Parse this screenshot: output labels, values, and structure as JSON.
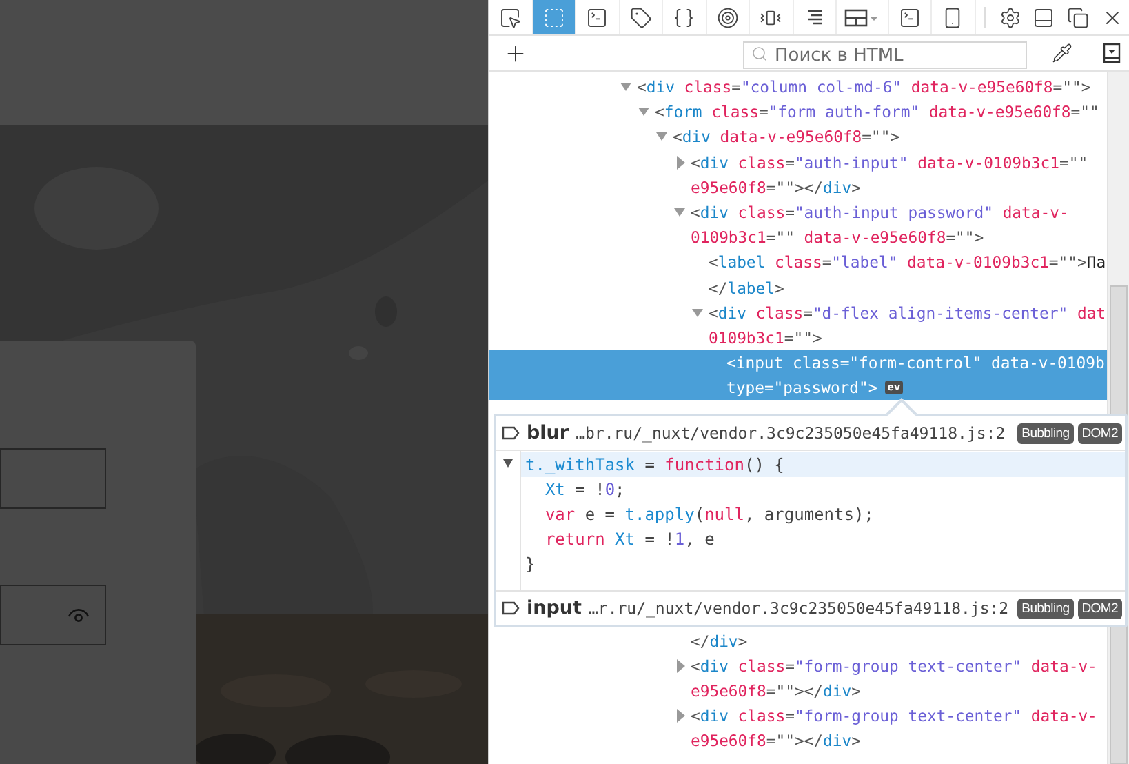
{
  "page": {
    "login_form": {
      "fields": [
        {
          "kind": "text"
        },
        {
          "kind": "password"
        }
      ]
    }
  },
  "devtools": {
    "toolbar": {
      "tabs": [
        {
          "kind": "pointer",
          "selected": false
        },
        {
          "kind": "frame",
          "selected": true
        },
        {
          "kind": "terminal",
          "selected": false
        },
        {
          "kind": "tag",
          "selected": false
        },
        {
          "kind": "braces",
          "selected": false
        },
        {
          "kind": "target",
          "selected": false
        },
        {
          "kind": "vibrate",
          "selected": false
        },
        {
          "kind": "lines",
          "selected": false
        },
        {
          "kind": "layout",
          "selected": false
        },
        {
          "kind": "terminal",
          "selected": false
        },
        {
          "kind": "phone",
          "selected": false
        }
      ],
      "buttons": [
        {
          "kind": "gear"
        },
        {
          "kind": "dock"
        },
        {
          "kind": "windows"
        },
        {
          "kind": "close"
        }
      ]
    },
    "search": {
      "placeholder": "Поиск в HTML"
    },
    "tree": [
      {
        "expanded": true,
        "selected": false,
        "lines": [
          [
            {
              "punct": "<"
            },
            {
              "tag": "div"
            },
            {
              "attr": " class"
            },
            {
              "punct": "="
            },
            {
              "value": "\"column col-md-6\""
            },
            {
              "attr": " data-v-e95e60f8"
            },
            {
              "punct": "=\"\">"
            }
          ]
        ],
        "children": [
          {
            "expanded": true,
            "selected": false,
            "lines": [
              [
                {
                  "punct": "<"
                },
                {
                  "tag": "form"
                },
                {
                  "attr": " class"
                },
                {
                  "punct": "="
                },
                {
                  "value": "\"form auth-form\""
                },
                {
                  "attr": " data-v-e95e60f8"
                },
                {
                  "punct": "=\"\""
                }
              ]
            ],
            "children": [
              {
                "expanded": true,
                "selected": false,
                "lines": [
                  [
                    {
                      "punct": "<"
                    },
                    {
                      "tag": "div"
                    },
                    {
                      "attr": " data-v-e95e60f8"
                    },
                    {
                      "punct": "=\"\">"
                    }
                  ]
                ],
                "children": [
                  {
                    "expanded": false,
                    "selected": false,
                    "lines": [
                      [
                        {
                          "punct": "<"
                        },
                        {
                          "tag": "div"
                        },
                        {
                          "attr": " class"
                        },
                        {
                          "punct": "="
                        },
                        {
                          "value": "\"auth-input\""
                        },
                        {
                          "attr": " data-v-0109b3c1"
                        },
                        {
                          "punct": "=\"\""
                        }
                      ],
                      [
                        {
                          "attr": "e95e60f8"
                        },
                        {
                          "punct": "=\"\"></"
                        },
                        {
                          "tag": "div"
                        },
                        {
                          "punct": ">"
                        }
                      ]
                    ]
                  },
                  {
                    "expanded": true,
                    "selected": false,
                    "lines": [
                      [
                        {
                          "punct": "<"
                        },
                        {
                          "tag": "div"
                        },
                        {
                          "attr": " class"
                        },
                        {
                          "punct": "="
                        },
                        {
                          "value": "\"auth-input password\""
                        },
                        {
                          "attr": " data-v-"
                        }
                      ],
                      [
                        {
                          "attr": "0109b3c1"
                        },
                        {
                          "punct": "=\"\""
                        },
                        {
                          "attr": " data-v-e95e60f8"
                        },
                        {
                          "punct": "=\"\">"
                        }
                      ]
                    ],
                    "children": [
                      {
                        "selected": false,
                        "lines": [
                          [
                            {
                              "punct": "<"
                            },
                            {
                              "tag": "label"
                            },
                            {
                              "attr": " class"
                            },
                            {
                              "punct": "="
                            },
                            {
                              "value": "\"label\""
                            },
                            {
                              "attr": " data-v-0109b3c1"
                            },
                            {
                              "punct": "=\"\">"
                            },
                            {
                              "text": "Па"
                            }
                          ],
                          [
                            {
                              "punct": "</"
                            },
                            {
                              "tag": "label"
                            },
                            {
                              "punct": ">"
                            }
                          ]
                        ]
                      },
                      {
                        "expanded": true,
                        "selected": false,
                        "lines": [
                          [
                            {
                              "punct": "<"
                            },
                            {
                              "tag": "div"
                            },
                            {
                              "attr": " class"
                            },
                            {
                              "punct": "="
                            },
                            {
                              "value": "\"d-flex align-items-center\""
                            },
                            {
                              "attr": " dat"
                            }
                          ],
                          [
                            {
                              "attr": "0109b3c1"
                            },
                            {
                              "punct": "=\"\">"
                            }
                          ]
                        ],
                        "children": [
                          {
                            "selected": true,
                            "badge": "ev",
                            "lines": [
                              [
                                {
                                  "punct": "<"
                                },
                                {
                                  "tag": "input"
                                },
                                {
                                  "attr": " class"
                                },
                                {
                                  "punct": "="
                                },
                                {
                                  "value": "\"form-control\""
                                },
                                {
                                  "attr": " data-v-0109b"
                                }
                              ],
                              [
                                {
                                  "attr": "type"
                                },
                                {
                                  "punct": "="
                                },
                                {
                                  "value": "\"password\""
                                },
                                {
                                  "punct": ">"
                                }
                              ]
                            ]
                          }
                        ]
                      }
                    ]
                  }
                ]
              }
            ]
          }
        ]
      }
    ],
    "tree_after": [
      {
        "selected": false,
        "lines": [
          [
            {
              "punct": "</"
            },
            {
              "tag": "div"
            },
            {
              "punct": ">"
            }
          ]
        ]
      },
      {
        "expanded": false,
        "selected": false,
        "lines": [
          [
            {
              "punct": "<"
            },
            {
              "tag": "div"
            },
            {
              "attr": " class"
            },
            {
              "punct": "="
            },
            {
              "value": "\"form-group text-center\""
            },
            {
              "attr": " data-v-"
            }
          ],
          [
            {
              "attr": "e95e60f8"
            },
            {
              "punct": "=\"\"></"
            },
            {
              "tag": "div"
            },
            {
              "punct": ">"
            }
          ]
        ]
      },
      {
        "expanded": false,
        "selected": false,
        "lines": [
          [
            {
              "punct": "<"
            },
            {
              "tag": "div"
            },
            {
              "attr": " class"
            },
            {
              "punct": "="
            },
            {
              "value": "\"form-group text-center\""
            },
            {
              "attr": " data-v-"
            }
          ],
          [
            {
              "attr": "e95e60f8"
            },
            {
              "punct": "=\"\"></"
            },
            {
              "tag": "div"
            },
            {
              "punct": ">"
            }
          ]
        ]
      }
    ],
    "event_listeners": [
      {
        "event": "blur",
        "source": "…br.ru/_nuxt/vendor.3c9c235050e45fa49118.js:2",
        "badges": [
          "Bubbling",
          "DOM2"
        ],
        "code": [
          [
            {
              "ident": "t._withTask"
            },
            {
              "plain": " = "
            },
            {
              "kw": "function"
            },
            {
              "plain": "() {"
            }
          ],
          [
            {
              "ident": "  Xt"
            },
            {
              "plain": " = !"
            },
            {
              "num": "0"
            },
            {
              "plain": ";"
            }
          ],
          [
            {
              "kw": "  var"
            },
            {
              "plain": " e = "
            },
            {
              "ident": "t.apply"
            },
            {
              "plain": "("
            },
            {
              "kw": "null"
            },
            {
              "plain": ", arguments);"
            }
          ],
          [
            {
              "kw": "  return"
            },
            {
              "ident": " Xt"
            },
            {
              "plain": " = !"
            },
            {
              "num": "1"
            },
            {
              "plain": ", e"
            }
          ],
          [
            {
              "plain": "}"
            }
          ]
        ]
      },
      {
        "event": "input",
        "source": "…r.ru/_nuxt/vendor.3c9c235050e45fa49118.js:2",
        "badges": [
          "Bubbling",
          "DOM2"
        ]
      }
    ]
  }
}
